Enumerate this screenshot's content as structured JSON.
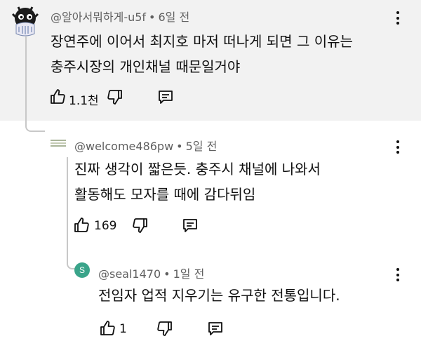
{
  "comments": [
    {
      "handle": "@알아서뭐하게-u5f",
      "time": "6일 전",
      "lines": [
        "장연주에 이어서 최지호 마저 떠나게 되면 그 이유는",
        "충주시장의 개인채널 때문일거야"
      ],
      "likes": "1.1천",
      "avatar_icon": "monster-face-icon"
    },
    {
      "handle": "@welcome486pw",
      "time": "5일 전",
      "lines": [
        "진짜 생각이 짧은듯. 충주시 채널에 나와서",
        "활동해도 모자를 때에 감다뒤임"
      ],
      "likes": "169",
      "avatar_icon": "striped-avatar-icon"
    },
    {
      "handle": "@seal1470",
      "time": "1일 전",
      "lines": [
        "전임자 업적 지우기는 유구한 전통입니다."
      ],
      "likes": "1",
      "avatar_letter": "S",
      "avatar_color": "#3aa48a"
    }
  ],
  "separator": "•",
  "colors": {
    "highlight_bg": "#f2f2f2",
    "meta": "#606060",
    "text": "#0f0f0f",
    "thread_line": "#c8c8c8"
  }
}
